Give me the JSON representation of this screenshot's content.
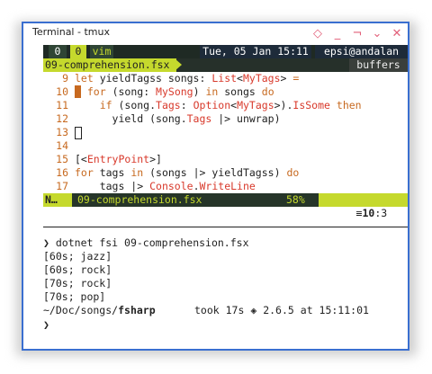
{
  "window": {
    "title": "Terminal - tmux",
    "border_color": "#3a6fd0"
  },
  "controls": [
    {
      "name": "pin-icon",
      "glyph": "◇"
    },
    {
      "name": "minimize-icon",
      "glyph": "_"
    },
    {
      "name": "maximize-icon",
      "glyph": "¬"
    },
    {
      "name": "shade-icon",
      "glyph": "⌄"
    },
    {
      "name": "close-icon",
      "glyph": "✕"
    }
  ],
  "tmux": {
    "session": "0",
    "window_index": "0",
    "window_name": "vim",
    "datetime": "Tue, 05 Jan 15:11",
    "user_host": "epsi@andalan"
  },
  "vim": {
    "buffer_tab": "09-comprehension.fsx",
    "buffers_label": "buffers",
    "lines": [
      {
        "n": "9",
        "text": "let yieldTagss songs: List<MyTags> ="
      },
      {
        "n": "10",
        "text": "  for (song: MySong) in songs do"
      },
      {
        "n": "11",
        "text": "    if (song.Tags: Option<MyTags>).IsSome then"
      },
      {
        "n": "12",
        "text": "      yield (song.Tags |> unwrap)"
      },
      {
        "n": "13",
        "text": ""
      },
      {
        "n": "14",
        "text": ""
      },
      {
        "n": "15",
        "text": "[<EntryPoint>]"
      },
      {
        "n": "16",
        "text": "for tags in (songs |> yieldTagss) do"
      },
      {
        "n": "17",
        "text": "    tags |> Console.WriteLine"
      }
    ],
    "status": {
      "mode": "N…",
      "file": "09-comprehension.fsx",
      "percent": "58%",
      "lineinfo_icon": "≡",
      "line": "10",
      "col": ":3"
    }
  },
  "shell": {
    "prompt_symbol": "❯",
    "command": "dotnet fsi 09-comprehension.fsx",
    "output": [
      "[60s; jazz]",
      "[60s; rock]",
      "[70s; rock]",
      "[70s; pop]"
    ],
    "cwd_prefix": "~/Doc/songs/",
    "cwd_bold": "fsharp",
    "took": "took 17s",
    "ruby_icon": "◈",
    "version": "2.6.5",
    "at_time": "at 15:11:01"
  },
  "colors": {
    "tmux_bg": "#1f2a24",
    "accent_green": "#c5d92d",
    "dark_bar": "#263529",
    "dark_blue": "#1e2b3a",
    "keyword": "#c7691f",
    "type": "#d8392b"
  }
}
